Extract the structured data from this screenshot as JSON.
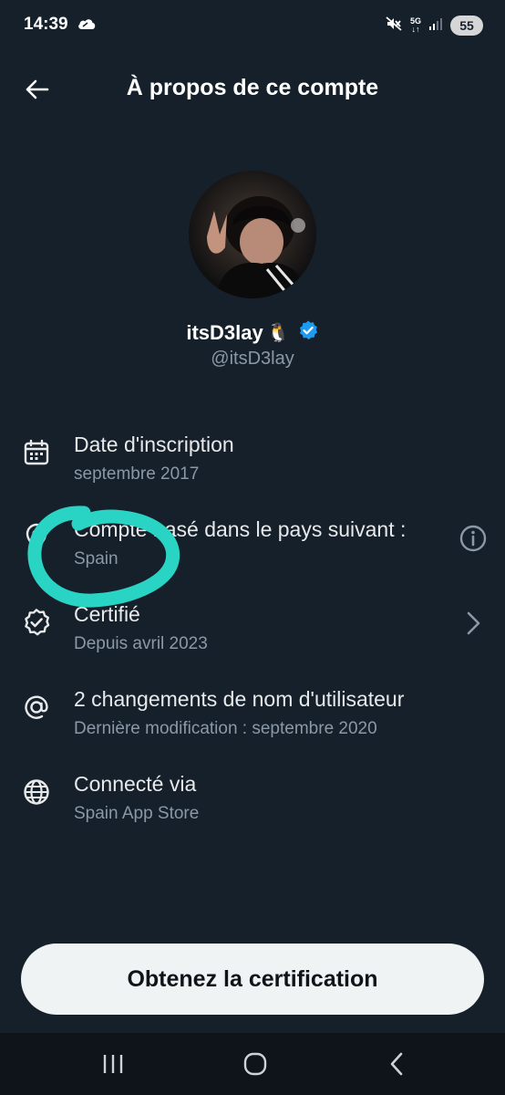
{
  "status_bar": {
    "time": "14:39",
    "network": "5G",
    "battery": "55"
  },
  "header": {
    "title": "À propos de ce compte"
  },
  "profile": {
    "display_name": "itsD3lay",
    "name_emoji": "🐧",
    "handle": "@itsD3lay",
    "verified": true
  },
  "info_items": [
    {
      "title": "Date d'inscription",
      "subtitle": "septembre 2017",
      "icon": "calendar-icon"
    },
    {
      "title": "Compte basé dans le pays suivant :",
      "subtitle": "Spain",
      "icon": "location-icon",
      "trailing": "info-icon"
    },
    {
      "title": "Certifié",
      "subtitle": "Depuis avril 2023",
      "icon": "verified-badge-icon",
      "trailing": "chevron-right-icon"
    },
    {
      "title": "2 changements de nom d'utilisateur",
      "subtitle": "Dernière modification : septembre 2020",
      "icon": "at-sign-icon"
    },
    {
      "title": "Connecté via",
      "subtitle": "Spain App Store",
      "icon": "globe-icon"
    }
  ],
  "cta": {
    "label": "Obtenez la certification"
  },
  "colors": {
    "background": "#15202b",
    "accent_verified": "#1d9bf0",
    "annotation": "#2ad4c4",
    "button_bg": "#eff3f4"
  }
}
